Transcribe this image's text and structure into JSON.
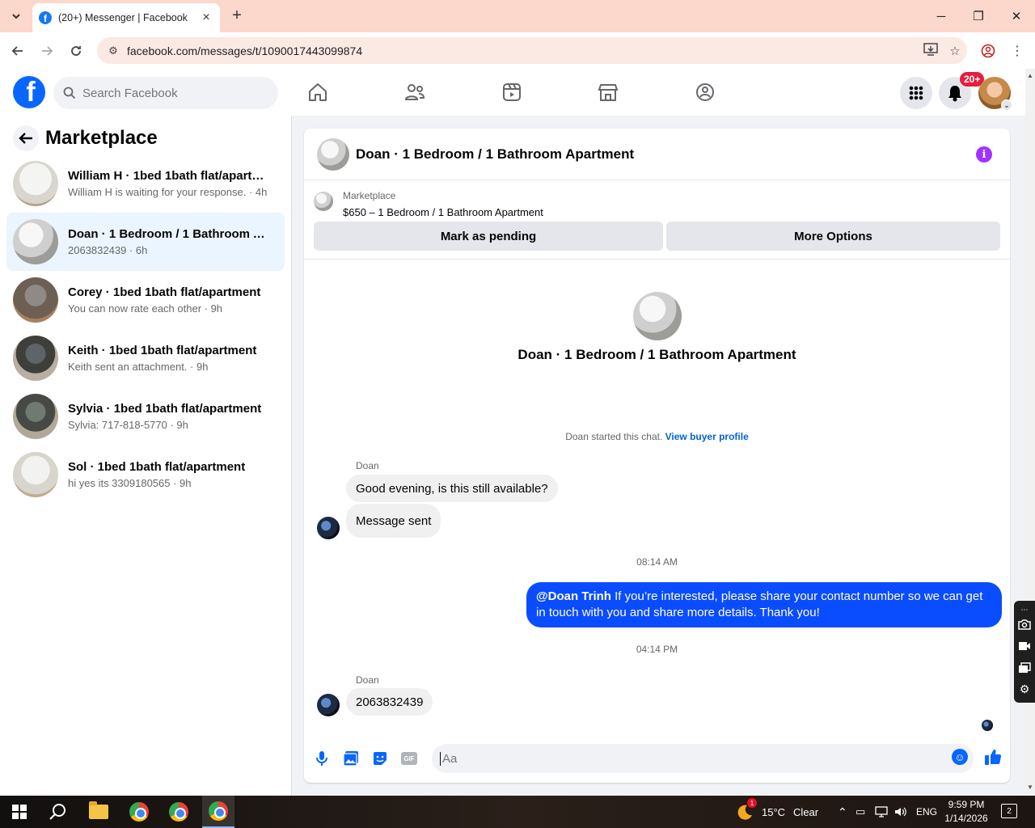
{
  "browser": {
    "tab_title": "(20+) Messenger | Facebook",
    "tab_favicon": "f",
    "new_tab_label": "+",
    "url": "facebook.com/messages/t/1090017443099874",
    "minimize": "─",
    "restore": "❐",
    "close": "✕"
  },
  "fb_nav": {
    "logo": "f",
    "search_placeholder": "Search Facebook",
    "notification_badge": "20+"
  },
  "sidebar": {
    "title": "Marketplace",
    "conversations": [
      {
        "name": "William H · 1bed 1bath flat/apartm...",
        "sub": "William H is waiting for your response. · 4h"
      },
      {
        "name": "Doan · 1 Bedroom / 1 Bathroom A...",
        "sub": "2063832439 · 6h"
      },
      {
        "name": "Corey · 1bed 1bath flat/apartment",
        "sub": "You can now rate each other · 9h"
      },
      {
        "name": "Keith · 1bed 1bath flat/apartment",
        "sub": "Keith sent an attachment. · 9h"
      },
      {
        "name": "Sylvia · 1bed 1bath flat/apartment",
        "sub": "Sylvia: 717-818-5770 · 9h"
      },
      {
        "name": "Sol · 1bed 1bath flat/apartment",
        "sub": "hi yes its 3309180565 · 9h"
      }
    ]
  },
  "chat": {
    "header_title": "Doan · 1 Bedroom / 1 Bathroom Apartment",
    "marketplace_label": "Marketplace",
    "listing": "$650 – 1 Bedroom / 1 Bathroom Apartment",
    "mark_pending": "Mark as pending",
    "more_options": "More Options",
    "center_title": "Doan · 1 Bedroom / 1 Bathroom Apartment",
    "started_text": "Doan started this chat. ",
    "view_buyer": "View buyer profile",
    "sender1": "Doan",
    "msg1": "Good evening, is this still available?",
    "msg2": "Message sent",
    "time1": "08:14 AM",
    "my_mention": "@Doan Trinh",
    "my_msg": " If you’re interested, please share your contact number so we can get in touch with you and share more details. Thank you!",
    "time2": "04:14 PM",
    "sender2": "Doan",
    "msg3": "2063832439",
    "composer_placeholder": "Aa",
    "gif_label": "GIF"
  },
  "taskbar": {
    "weather_temp": "15°C",
    "weather_cond": "Clear",
    "lang": "ENG",
    "time": "9:59 PM",
    "date": "1/14/2026",
    "notif_count": "2",
    "weather_alert": "1"
  }
}
